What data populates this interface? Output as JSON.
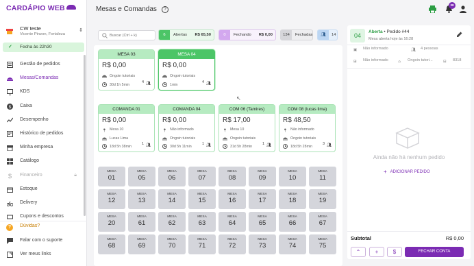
{
  "brand": {
    "logo_text": "CARDÁPIO WEB",
    "accent": "#7b2bb3",
    "success": "#4cc567"
  },
  "store": {
    "name": "CW teste",
    "address": "Vicente Pinzon, Fortaleza"
  },
  "status": {
    "closes_text": "Fecha às 22h30"
  },
  "nav": [
    {
      "label": "Gestão de pedidos",
      "icon": "orders-icon"
    },
    {
      "label": "Mesas/Comandas",
      "icon": "tables-icon",
      "active": true
    },
    {
      "label": "KDS",
      "icon": "kds-icon"
    },
    {
      "label": "Caixa",
      "icon": "cash-icon"
    },
    {
      "label": "Desempenho",
      "icon": "chart-icon"
    },
    {
      "label": "Histórico de pedidos",
      "icon": "history-icon"
    },
    {
      "label": "Minha empresa",
      "icon": "store-icon"
    },
    {
      "label": "Catálogo",
      "icon": "catalog-icon"
    },
    {
      "label": "Financeiro",
      "icon": "dollar-icon",
      "disabled": true
    },
    {
      "label": "Estoque",
      "icon": "stock-icon"
    },
    {
      "label": "Delivery",
      "icon": "bike-icon"
    },
    {
      "label": "Cupons e descontos",
      "icon": "coupon-icon"
    }
  ],
  "bottom_nav": [
    {
      "label": "Dúvidas?",
      "icon": "help-icon"
    },
    {
      "label": "Falar com o suporte",
      "icon": "chat-icon"
    },
    {
      "label": "Ver meus links",
      "icon": "link-icon"
    }
  ],
  "header": {
    "title": "Mesas e Comandas",
    "notification_count": "38"
  },
  "search": {
    "placeholder": "Buscar (Ctrl + k)"
  },
  "filters": {
    "open": {
      "count": "6",
      "label": "Abertas",
      "amount": "R$ 65,50"
    },
    "closing": {
      "count": "0",
      "label": "Fechando",
      "amount": "R$ 0,00"
    },
    "closed": {
      "count": "134",
      "label": "Fechadas"
    },
    "people": {
      "count": "14"
    }
  },
  "open_cards": [
    {
      "title": "MESA 03",
      "amount": "R$ 0,00",
      "waiter": "Ongoin tutoriais",
      "time": "30d 1h 5min",
      "people": "4",
      "selected": false
    },
    {
      "title": "MESA 04",
      "amount": "R$ 0,00",
      "waiter": "Ongoin tutoriais",
      "time": "1min",
      "people": "4",
      "selected": true
    },
    {
      "title": "COMANDA 01",
      "amount": "R$ 0,00",
      "location": "Mesa 10",
      "customer": "Lucas Lima",
      "time": "18d 5h 38min",
      "people": "1"
    },
    {
      "title": "COMANDA 04",
      "amount": "R$ 0,00",
      "location": "Não informado",
      "customer": "Ongoin tutoriais",
      "time": "30d 5h 11min",
      "people": "1"
    },
    {
      "title": "COM 06  (Tamires)",
      "amount": "R$ 17,00",
      "location": "Mesa 10",
      "customer": "Ongoin tutoriais",
      "time": "31d 5h 28min",
      "people": "1"
    },
    {
      "title": "COM 08  (lucas lima)",
      "amount": "R$ 48,50",
      "location": "Não informado",
      "customer": "Ongoin tutoriais",
      "time": "18d 5h 28min",
      "people": "3"
    }
  ],
  "tiles": {
    "label": "MESA",
    "numbers": [
      "01",
      "05",
      "06",
      "07",
      "08",
      "09",
      "10",
      "11",
      "12",
      "13",
      "14",
      "15",
      "16",
      "17",
      "18",
      "19",
      "20",
      "61",
      "62",
      "63",
      "64",
      "65",
      "66",
      "67",
      "68",
      "69",
      "70",
      "71",
      "72",
      "73",
      "74",
      "75"
    ]
  },
  "order_panel": {
    "table_number": "04",
    "status": "Aberta",
    "order_label": "• Pedido #44",
    "opened": "Mesa aberta hoje às 16:28",
    "customer": "Não informado",
    "people": "4 pessoas",
    "location": "Não informado",
    "waiter": "Ongoin tutori...",
    "code": "8318",
    "empty_text": "Ainda não há nenhum pedido",
    "add_label": "ADICIONAR PEDIDO",
    "subtotal_label": "Subtotal",
    "subtotal_value": "R$ 0,00",
    "close_label": "FECHAR CONTA"
  }
}
